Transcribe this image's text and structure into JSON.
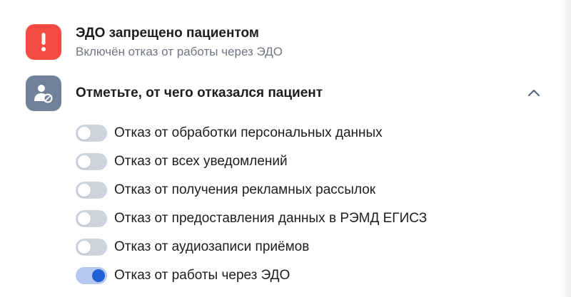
{
  "alert": {
    "title": "ЭДО запрещено пациентом",
    "subtitle": "Включён отказ от работы через ЭДО",
    "icon": "exclamation-icon",
    "color": "#f54b43"
  },
  "section": {
    "title": "Отметьте, от чего отказался пациент",
    "icon": "user-blocked-icon",
    "expanded": true
  },
  "options": [
    {
      "label": "Отказ от обработки персональных данных",
      "checked": false
    },
    {
      "label": "Отказ от всех уведомлений",
      "checked": false
    },
    {
      "label": "Отказ от получения рекламных рассылок",
      "checked": false
    },
    {
      "label": "Отказ от предоставления данных в РЭМД ЕГИСЗ",
      "checked": false
    },
    {
      "label": "Отказ от аудиозаписи приёмов",
      "checked": false
    },
    {
      "label": "Отказ от работы через ЭДО",
      "checked": true
    }
  ],
  "colors": {
    "accent": "#1f5fd6",
    "toggle_off": "#cdd4de",
    "toggle_on_track": "#b5c8f0",
    "section_icon_bg": "#6f8299"
  }
}
